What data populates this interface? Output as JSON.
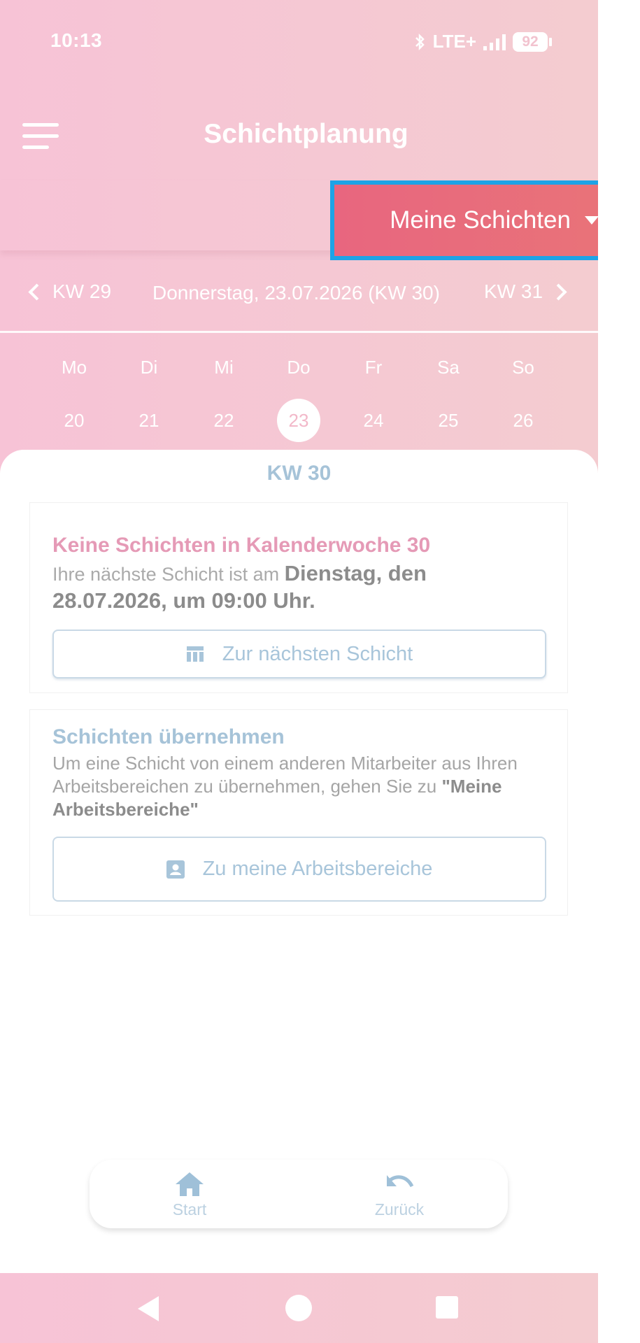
{
  "status_bar": {
    "time": "10:13",
    "network": "LTE+",
    "battery": "92",
    "bluetooth_icon": "bluetooth-icon",
    "signal_icon": "signal-icon"
  },
  "header": {
    "title": "Schichtplanung",
    "menu_icon": "hamburger-menu-icon"
  },
  "filter": {
    "label": "Meine Schichten"
  },
  "week_nav": {
    "prev": "KW 29",
    "current": "Donnerstag, 23.07.2026 (KW 30)",
    "next": "KW 31"
  },
  "days": [
    {
      "name": "Mo",
      "num": "20"
    },
    {
      "name": "Di",
      "num": "21"
    },
    {
      "name": "Mi",
      "num": "22"
    },
    {
      "name": "Do",
      "num": "23",
      "selected": true
    },
    {
      "name": "Fr",
      "num": "24"
    },
    {
      "name": "Sa",
      "num": "25"
    },
    {
      "name": "So",
      "num": "26"
    }
  ],
  "content": {
    "week_label": "KW 30",
    "no_shifts": {
      "title": "Keine Schichten in Kalenderwoche 30",
      "text_prefix": "Ihre nächste Schicht ist am ",
      "text_bold": "Dienstag, den 28.07.2026, um 09:00 Uhr.",
      "button": "Zur nächsten Schicht"
    },
    "take_over": {
      "title": "Schichten übernehmen",
      "text_prefix": "Um eine Schicht von einem anderen Mitarbeiter aus Ihren Arbeitsbereichen zu übernehmen, gehen Sie zu ",
      "text_bold": "\"Meine Arbeitsbereiche\"",
      "button": "Zu meine Arbeitsbereiche"
    }
  },
  "tabbar": {
    "start": "Start",
    "back": "Zurück"
  },
  "colors": {
    "accent": "#e8667f",
    "highlight_border": "#1ea3e6",
    "muted_blue": "#a6c3d8",
    "pink_title": "#e59ab6"
  }
}
